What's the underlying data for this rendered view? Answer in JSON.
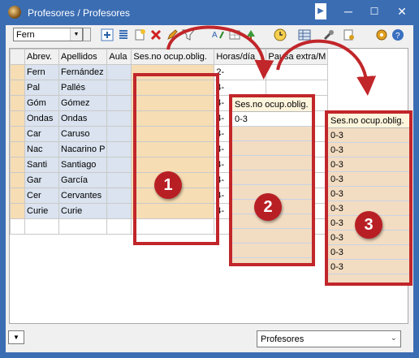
{
  "window": {
    "title": "Profesores / Profesores"
  },
  "toolbar": {
    "teacher_select": "Fern"
  },
  "grid": {
    "columns": [
      "Abrev.",
      "Apellidos",
      "Aula",
      "Ses.no ocup.oblig.",
      "Horas/día",
      "Pausa extra/M"
    ],
    "rows": [
      {
        "abrev": "Fern",
        "apellidos": "Fernández",
        "horas": "2-"
      },
      {
        "abrev": "Pal",
        "apellidos": "Pallés",
        "horas": "4-"
      },
      {
        "abrev": "Góm",
        "apellidos": "Gómez",
        "horas": "4-"
      },
      {
        "abrev": "Ondas",
        "apellidos": "Ondas",
        "horas": "4-"
      },
      {
        "abrev": "Car",
        "apellidos": "Caruso",
        "horas": "4-"
      },
      {
        "abrev": "Nac",
        "apellidos": "Nacarino P",
        "horas": "4-"
      },
      {
        "abrev": "Santi",
        "apellidos": "Santiago",
        "horas": "4-"
      },
      {
        "abrev": "Gar",
        "apellidos": "García",
        "horas": "4-"
      },
      {
        "abrev": "Cer",
        "apellidos": "Cervantes",
        "horas": "4-"
      },
      {
        "abrev": "Curie",
        "apellidos": "Curie",
        "horas": "4-"
      }
    ]
  },
  "panel2": {
    "header": "Ses.no ocup.oblig.",
    "first_value": "0-3"
  },
  "panel3": {
    "header": "Ses.no ocup.oblig.",
    "values": [
      "0-3",
      "0-3",
      "0-3",
      "0-3",
      "0-3",
      "0-3",
      "0-3",
      "0-3",
      "0-3",
      "0-3"
    ]
  },
  "badges": {
    "one": "1",
    "two": "2",
    "three": "3"
  },
  "status": {
    "view_select": "Profesores"
  },
  "colors": {
    "highlight": "#c1262a",
    "cell_fill": "#f2dcc2",
    "title_bar": "#3b6db3"
  }
}
